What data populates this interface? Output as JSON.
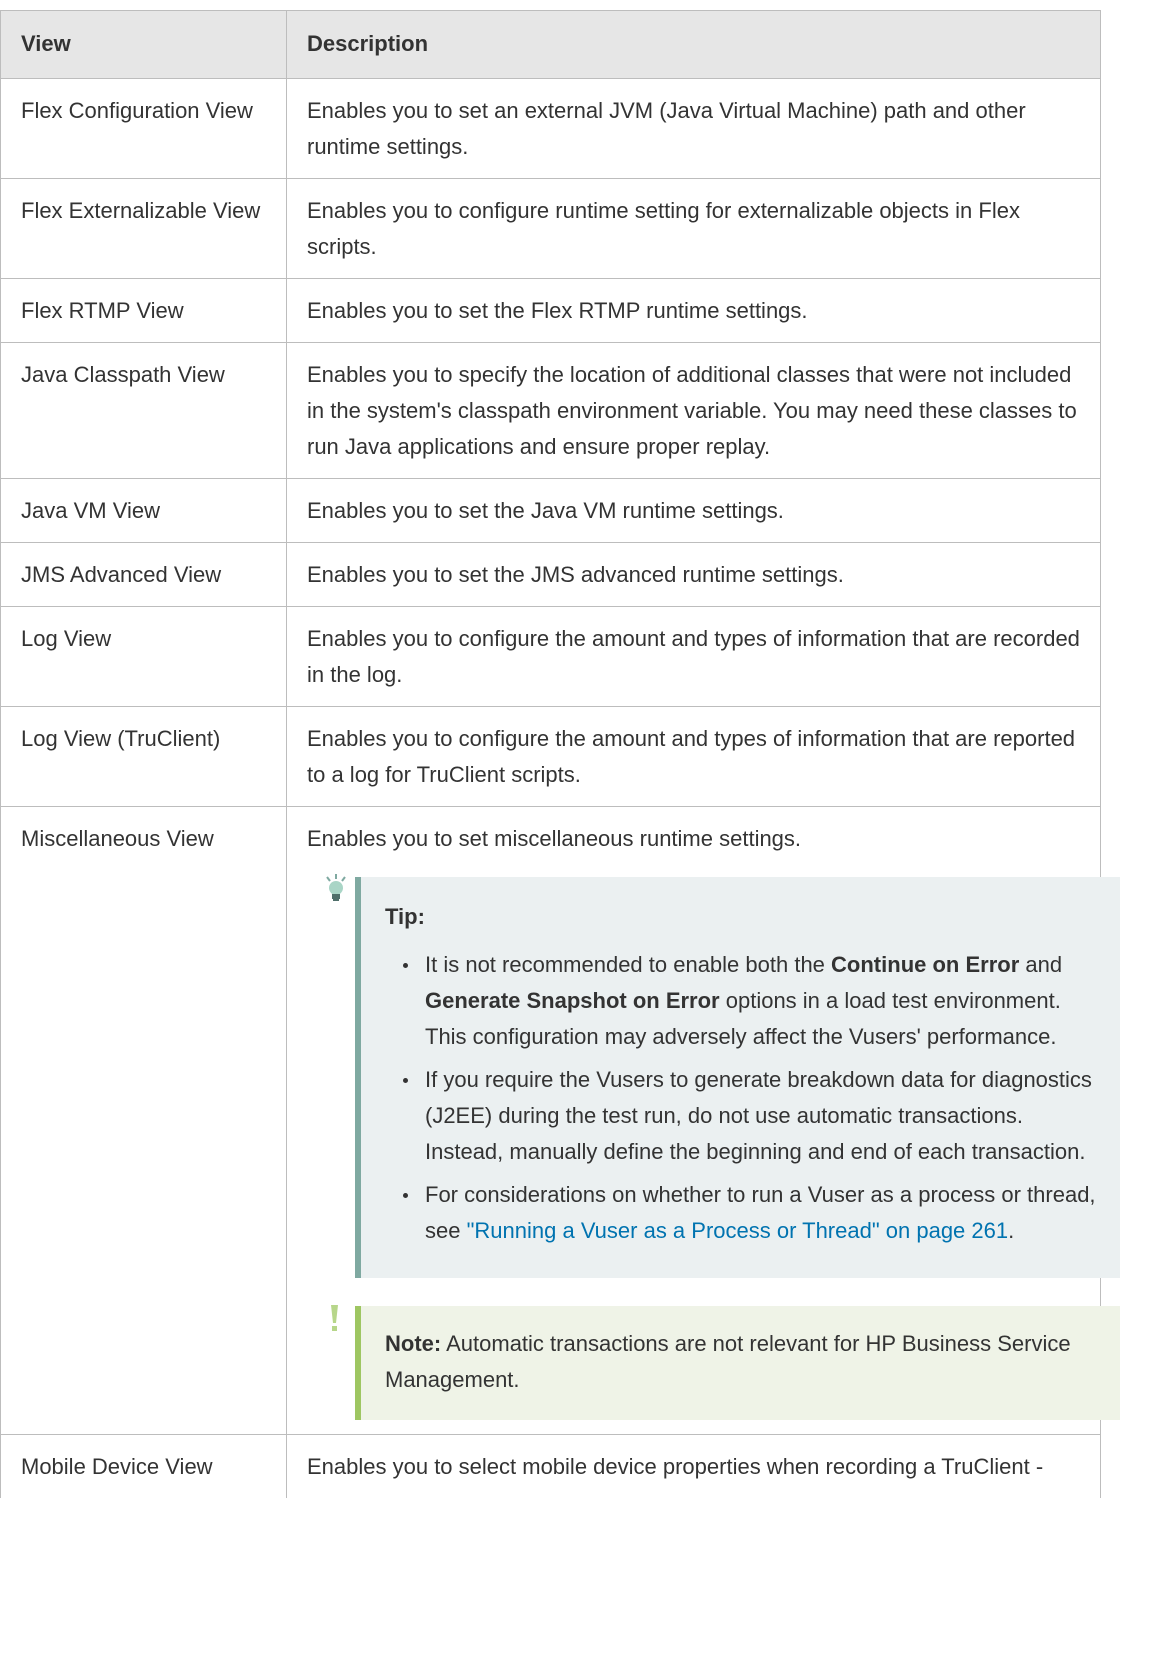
{
  "table": {
    "headers": {
      "view": "View",
      "description": "Description"
    },
    "rows": [
      {
        "view": "Flex Configuration View",
        "description": "Enables you to set an external JVM (Java Virtual Machine) path and other runtime settings."
      },
      {
        "view": "Flex Externalizable View",
        "description": "Enables you to configure runtime setting for externalizable objects in Flex scripts."
      },
      {
        "view": "Flex RTMP View",
        "description": "Enables you to set the Flex RTMP runtime settings."
      },
      {
        "view": "Java Classpath View",
        "description": "Enables you to specify the location of additional classes that were not included in the system's classpath environment variable. You may need these classes to run Java applications and ensure proper replay."
      },
      {
        "view": "Java VM View",
        "description": "Enables you to set the Java VM runtime settings."
      },
      {
        "view": "JMS Advanced View",
        "description": "Enables you to set the JMS advanced runtime settings."
      },
      {
        "view": "Log View",
        "description": "Enables you to configure the amount and types of information that are recorded in the log."
      },
      {
        "view": "Log View (TruClient)",
        "description": "Enables you to configure the amount and types of information that are reported to a log for TruClient scripts."
      },
      {
        "view": "Miscellaneous View",
        "description": "Enables you to set miscellaneous runtime settings."
      },
      {
        "view": "Mobile Device View",
        "description": "Enables you to select mobile device properties when recording a TruClient -"
      }
    ]
  },
  "tip": {
    "title": "Tip:",
    "item1": {
      "t1": "It is not recommended to enable both the ",
      "b1": "Continue on Error",
      "t2": " and ",
      "b2": "Generate Snapshot on Error",
      "t3": " options in a load test environment. This configuration may adversely affect the Vusers' performance."
    },
    "item2": "If you require the Vusers to generate breakdown data for diagnostics (J2EE) during the test run, do not use automatic transactions. Instead, manually define the beginning and end of each transaction.",
    "item3": {
      "t1": "For considerations on whether to run a Vuser as a process or thread, see ",
      "link": "\"Running a Vuser as a Process or Thread\" on page 261",
      "t2": "."
    }
  },
  "note": {
    "label": "Note:",
    "text": " Automatic transactions are not relevant for HP Business Service Management."
  },
  "icons": {
    "tip": "lightbulb-icon",
    "note": "exclamation-icon"
  },
  "colors": {
    "tip_accent": "#7fa9a1",
    "note_accent": "#9ec662",
    "link": "#0073b0",
    "header_bg": "#e6e6e6"
  }
}
